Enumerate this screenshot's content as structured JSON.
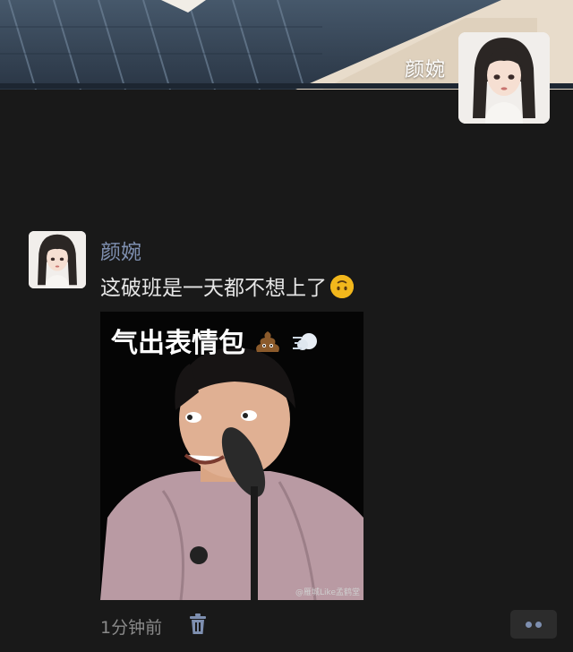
{
  "header": {
    "owner_name": "颜婉"
  },
  "post": {
    "author": "颜婉",
    "text": "这破班是一天都不想上了",
    "text_emoji": "upside-down-face-icon",
    "image": {
      "caption": "气出表情包",
      "caption_emojis": [
        "poop-icon",
        "dash-icon"
      ],
      "watermark": "@雁城Like孟鹤堂"
    },
    "timestamp": "1分钟前",
    "delete_icon": "trash-icon",
    "more_icon": "more-dots-icon"
  },
  "colors": {
    "background": "#191919",
    "author_link": "#7e8fb0",
    "text": "#e6e6e6",
    "muted": "#8a8a8a"
  }
}
